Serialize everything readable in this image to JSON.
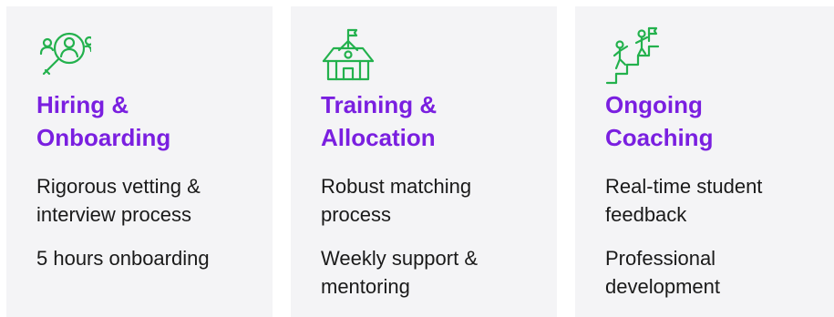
{
  "cards": [
    {
      "icon": "people-search-icon",
      "title": "Hiring & Onboarding",
      "items": [
        "Rigorous vetting & interview process",
        "5 hours onboarding"
      ]
    },
    {
      "icon": "schoolhouse-icon",
      "title": "Training & Allocation",
      "items": [
        "Robust matching process",
        "Weekly support & mentoring"
      ]
    },
    {
      "icon": "climbing-stairs-icon",
      "title": "Ongoing Coaching",
      "items": [
        "Real-time student feedback",
        "Professional development"
      ]
    }
  ],
  "colors": {
    "accent": "#7a1fe0",
    "icon_stroke": "#23b14d",
    "card_bg": "#f4f4f6",
    "text": "#1a1a1a"
  }
}
